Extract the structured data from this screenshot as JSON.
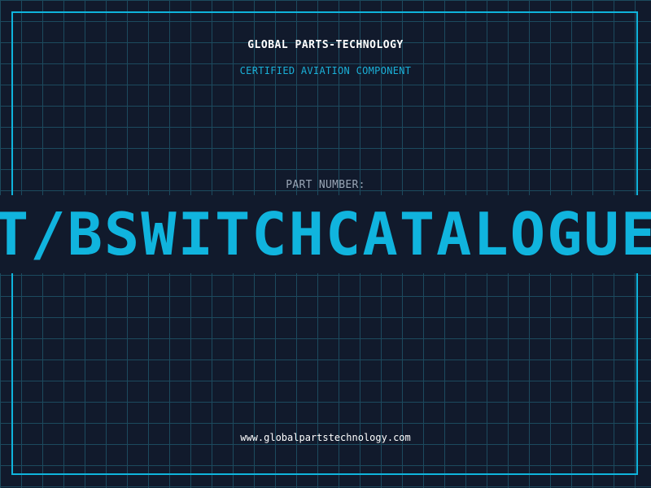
{
  "header": {
    "brand": "GLOBAL PARTS-TECHNOLOGY",
    "subtitle": "CERTIFIED AVIATION COMPONENT"
  },
  "part": {
    "label": "PART NUMBER:",
    "number": "T/BSWITCHCATALOGUE"
  },
  "footer": {
    "website": "www.globalpartstechnology.com"
  },
  "colors": {
    "background": "#111a2c",
    "grid": "#1c4a5e",
    "accent": "#10b4de",
    "label": "#9aa6b6"
  }
}
